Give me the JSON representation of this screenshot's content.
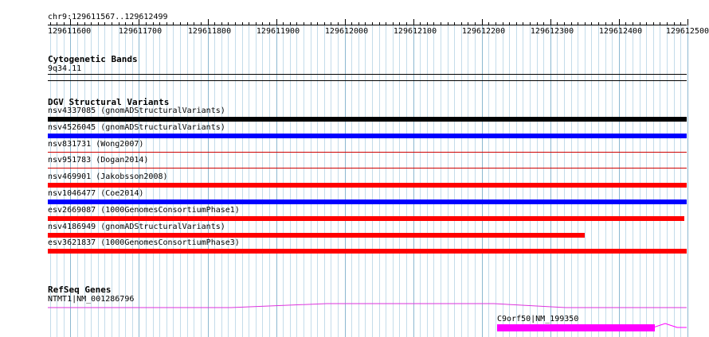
{
  "ruler": {
    "location": "chr9:129611567..129612499",
    "ticks": [
      "129611600",
      "129611700",
      "129611800",
      "129611900",
      "129612000",
      "129612100",
      "129612200",
      "129612300",
      "129612400",
      "129612500"
    ]
  },
  "tracks": {
    "cytoband": {
      "title": "Cytogenetic Bands",
      "band": "9q34.11"
    },
    "dgv": {
      "title": "DGV Structural Variants",
      "features": [
        {
          "label": "nsv4337085 (gnomADStructuralVariants)",
          "color": "#000000",
          "start": 129611567,
          "end": 129612499,
          "style": "thick"
        },
        {
          "label": "nsv4526045 (gnomADStructuralVariants)",
          "color": "#0000ff",
          "start": 129611567,
          "end": 129612499,
          "style": "thick"
        },
        {
          "label": "nsv831731 (Wong2007)",
          "color": "#cc0000",
          "start": 129611567,
          "end": 129612499,
          "style": "thin"
        },
        {
          "label": "nsv951783 (Dogan2014)",
          "color": "#cc0000",
          "start": 129611567,
          "end": 129612499,
          "style": "thin"
        },
        {
          "label": "nsv469901 (Jakobsson2008)",
          "color": "#ff0000",
          "start": 129611567,
          "end": 129612499,
          "style": "thick"
        },
        {
          "label": "nsv1046477 (Coe2014)",
          "color": "#0000ff",
          "start": 129611567,
          "end": 129612499,
          "style": "thick"
        },
        {
          "label": "esv2669087 (1000GenomesConsortiumPhase1)",
          "color": "#ff0000",
          "start": 129611567,
          "end": 129612496,
          "style": "thick"
        },
        {
          "label": "nsv4186949 (gnomADStructuralVariants)",
          "color": "#ff0000",
          "start": 129611567,
          "end": 129612350,
          "style": "thick"
        },
        {
          "label": "esv3621837 (1000GenomesConsortiumPhase3)",
          "color": "#ff0000",
          "start": 129611567,
          "end": 129612499,
          "style": "thick"
        }
      ]
    },
    "refseq": {
      "title": "RefSeq Genes",
      "genes": [
        {
          "label": "NTMT1|NM_001286796",
          "color": "#dd33dd"
        },
        {
          "label": "C9orf50|NM_199350",
          "color": "#ff00ff"
        }
      ]
    }
  },
  "colors": {
    "grid_major": "#8cb8d0",
    "grid_minor": "#c4dcea",
    "separator": "#000000",
    "gene": "#ff00ff"
  }
}
